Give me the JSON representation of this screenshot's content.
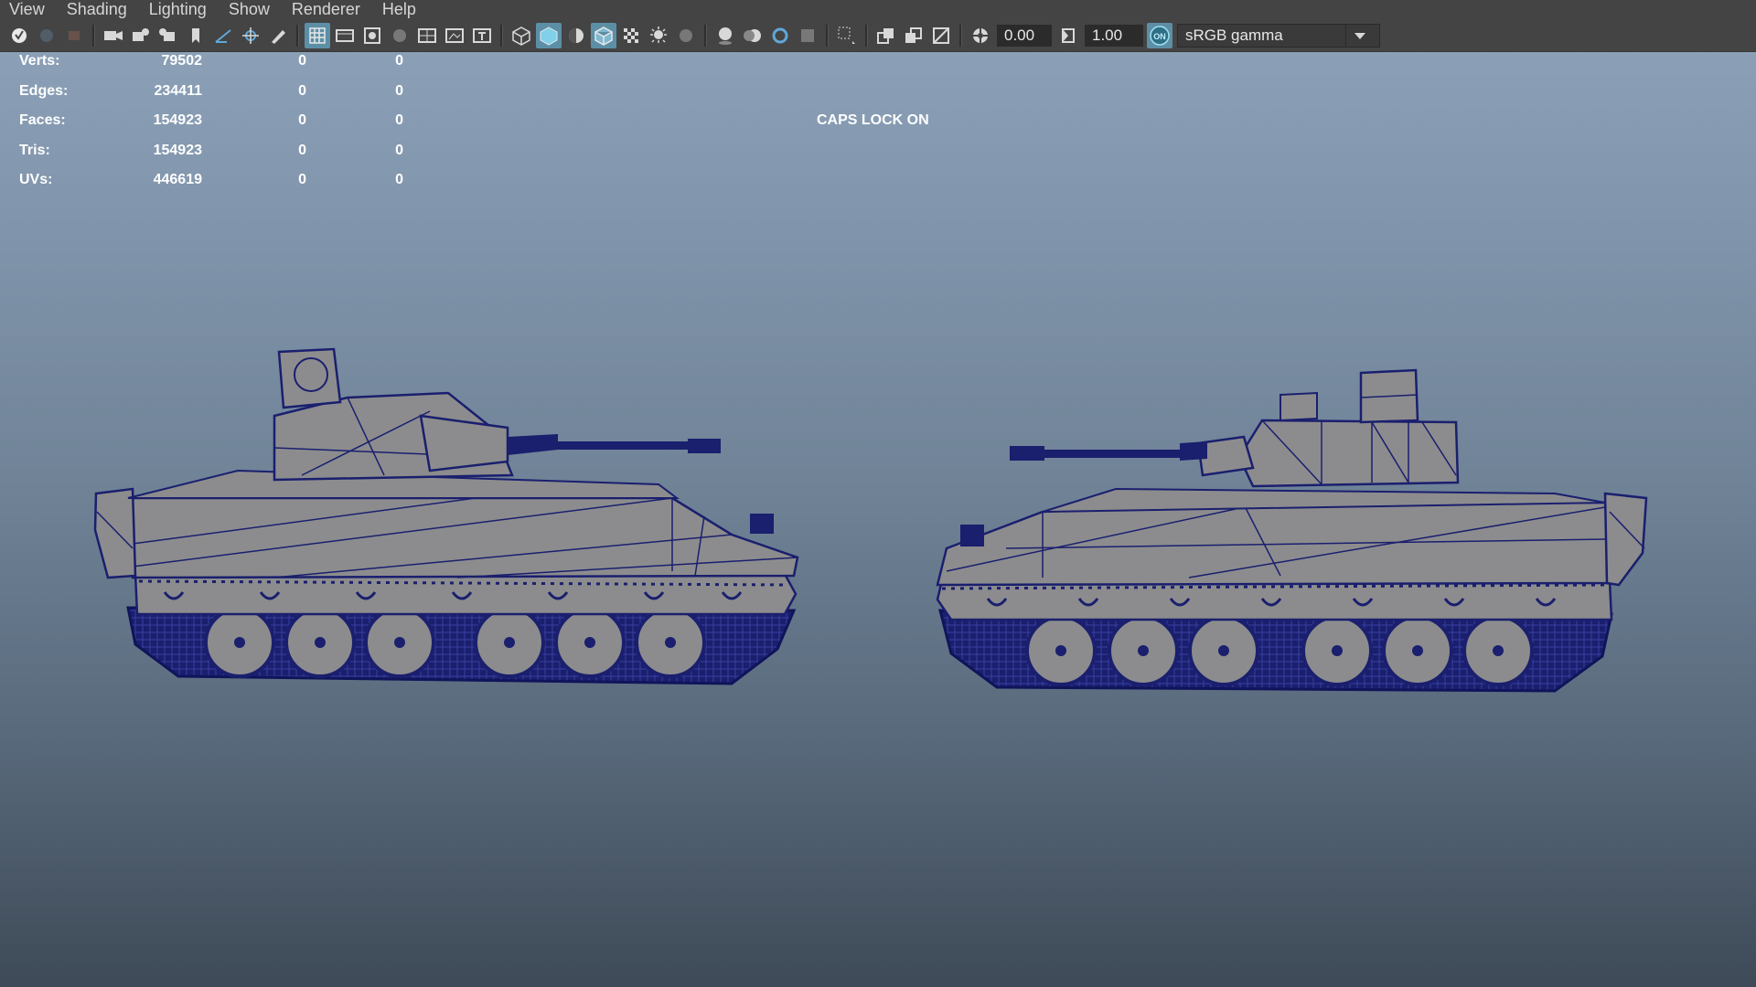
{
  "menu": [
    "View",
    "Shading",
    "Lighting",
    "Show",
    "Renderer",
    "Help"
  ],
  "toolbar": {
    "exposure_value": "0.00",
    "gamma_value": "1.00",
    "colorspace_toggle": "ON",
    "colorspace_label": "sRGB gamma",
    "icons": [
      "select-camera-icon",
      "camera-attributes-icon",
      "bookmarks-icon",
      "image-plane-icon",
      "grease-pencil-icon",
      "grid-icon",
      "film-gate-icon",
      "resolution-gate-icon",
      "gate-mask-icon",
      "field-chart-icon",
      "safe-action-icon",
      "safe-title-icon",
      "wireframe-icon",
      "smooth-shade-icon",
      "wireframe-on-shaded-icon",
      "textured-icon",
      "use-all-lights-icon",
      "shadows-icon",
      "screen-space-ao-icon",
      "motion-blur-icon",
      "anti-aliasing-icon",
      "depth-of-field-icon",
      "isolate-select-icon",
      "xray-icon",
      "xray-joints-icon",
      "xray-active-icon",
      "exposure-icon",
      "gamma-icon",
      "color-management-icon"
    ]
  },
  "hud": {
    "rows": [
      {
        "label": "Verts:",
        "total": "79502",
        "selected": "0",
        "tris_sel": "0"
      },
      {
        "label": "Edges:",
        "total": "234411",
        "selected": "0",
        "tris_sel": "0"
      },
      {
        "label": "Faces:",
        "total": "154923",
        "selected": "0",
        "tris_sel": "0"
      },
      {
        "label": "Tris:",
        "total": "154923",
        "selected": "0",
        "tris_sel": "0"
      },
      {
        "label": "UVs:",
        "total": "446619",
        "selected": "0",
        "tris_sel": "0"
      }
    ]
  },
  "caps_lock": "CAPS LOCK ON",
  "colors": {
    "viewport_top": "#8ea3ba",
    "viewport_bottom": "#3e4a57",
    "wireframe": "#1a1f6e",
    "mesh_fill": "#8c8c8e",
    "toolbar_bg": "#444444",
    "toggle_active": "#5c8fa6"
  }
}
